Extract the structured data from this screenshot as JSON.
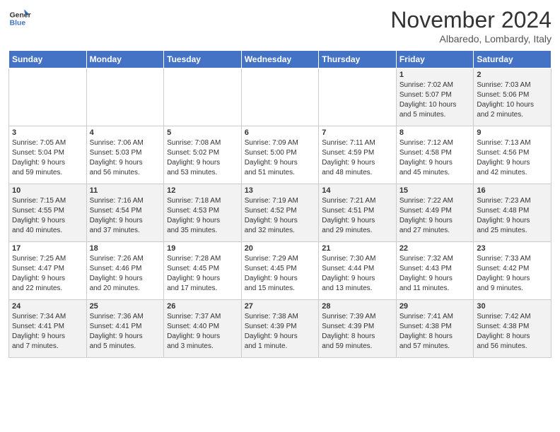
{
  "header": {
    "logo_general": "General",
    "logo_blue": "Blue",
    "month_title": "November 2024",
    "location": "Albaredo, Lombardy, Italy"
  },
  "days_of_week": [
    "Sunday",
    "Monday",
    "Tuesday",
    "Wednesday",
    "Thursday",
    "Friday",
    "Saturday"
  ],
  "weeks": [
    [
      {
        "day": "",
        "info": ""
      },
      {
        "day": "",
        "info": ""
      },
      {
        "day": "",
        "info": ""
      },
      {
        "day": "",
        "info": ""
      },
      {
        "day": "",
        "info": ""
      },
      {
        "day": "1",
        "info": "Sunrise: 7:02 AM\nSunset: 5:07 PM\nDaylight: 10 hours\nand 5 minutes."
      },
      {
        "day": "2",
        "info": "Sunrise: 7:03 AM\nSunset: 5:06 PM\nDaylight: 10 hours\nand 2 minutes."
      }
    ],
    [
      {
        "day": "3",
        "info": "Sunrise: 7:05 AM\nSunset: 5:04 PM\nDaylight: 9 hours\nand 59 minutes."
      },
      {
        "day": "4",
        "info": "Sunrise: 7:06 AM\nSunset: 5:03 PM\nDaylight: 9 hours\nand 56 minutes."
      },
      {
        "day": "5",
        "info": "Sunrise: 7:08 AM\nSunset: 5:02 PM\nDaylight: 9 hours\nand 53 minutes."
      },
      {
        "day": "6",
        "info": "Sunrise: 7:09 AM\nSunset: 5:00 PM\nDaylight: 9 hours\nand 51 minutes."
      },
      {
        "day": "7",
        "info": "Sunrise: 7:11 AM\nSunset: 4:59 PM\nDaylight: 9 hours\nand 48 minutes."
      },
      {
        "day": "8",
        "info": "Sunrise: 7:12 AM\nSunset: 4:58 PM\nDaylight: 9 hours\nand 45 minutes."
      },
      {
        "day": "9",
        "info": "Sunrise: 7:13 AM\nSunset: 4:56 PM\nDaylight: 9 hours\nand 42 minutes."
      }
    ],
    [
      {
        "day": "10",
        "info": "Sunrise: 7:15 AM\nSunset: 4:55 PM\nDaylight: 9 hours\nand 40 minutes."
      },
      {
        "day": "11",
        "info": "Sunrise: 7:16 AM\nSunset: 4:54 PM\nDaylight: 9 hours\nand 37 minutes."
      },
      {
        "day": "12",
        "info": "Sunrise: 7:18 AM\nSunset: 4:53 PM\nDaylight: 9 hours\nand 35 minutes."
      },
      {
        "day": "13",
        "info": "Sunrise: 7:19 AM\nSunset: 4:52 PM\nDaylight: 9 hours\nand 32 minutes."
      },
      {
        "day": "14",
        "info": "Sunrise: 7:21 AM\nSunset: 4:51 PM\nDaylight: 9 hours\nand 29 minutes."
      },
      {
        "day": "15",
        "info": "Sunrise: 7:22 AM\nSunset: 4:49 PM\nDaylight: 9 hours\nand 27 minutes."
      },
      {
        "day": "16",
        "info": "Sunrise: 7:23 AM\nSunset: 4:48 PM\nDaylight: 9 hours\nand 25 minutes."
      }
    ],
    [
      {
        "day": "17",
        "info": "Sunrise: 7:25 AM\nSunset: 4:47 PM\nDaylight: 9 hours\nand 22 minutes."
      },
      {
        "day": "18",
        "info": "Sunrise: 7:26 AM\nSunset: 4:46 PM\nDaylight: 9 hours\nand 20 minutes."
      },
      {
        "day": "19",
        "info": "Sunrise: 7:28 AM\nSunset: 4:45 PM\nDaylight: 9 hours\nand 17 minutes."
      },
      {
        "day": "20",
        "info": "Sunrise: 7:29 AM\nSunset: 4:45 PM\nDaylight: 9 hours\nand 15 minutes."
      },
      {
        "day": "21",
        "info": "Sunrise: 7:30 AM\nSunset: 4:44 PM\nDaylight: 9 hours\nand 13 minutes."
      },
      {
        "day": "22",
        "info": "Sunrise: 7:32 AM\nSunset: 4:43 PM\nDaylight: 9 hours\nand 11 minutes."
      },
      {
        "day": "23",
        "info": "Sunrise: 7:33 AM\nSunset: 4:42 PM\nDaylight: 9 hours\nand 9 minutes."
      }
    ],
    [
      {
        "day": "24",
        "info": "Sunrise: 7:34 AM\nSunset: 4:41 PM\nDaylight: 9 hours\nand 7 minutes."
      },
      {
        "day": "25",
        "info": "Sunrise: 7:36 AM\nSunset: 4:41 PM\nDaylight: 9 hours\nand 5 minutes."
      },
      {
        "day": "26",
        "info": "Sunrise: 7:37 AM\nSunset: 4:40 PM\nDaylight: 9 hours\nand 3 minutes."
      },
      {
        "day": "27",
        "info": "Sunrise: 7:38 AM\nSunset: 4:39 PM\nDaylight: 9 hours\nand 1 minute."
      },
      {
        "day": "28",
        "info": "Sunrise: 7:39 AM\nSunset: 4:39 PM\nDaylight: 8 hours\nand 59 minutes."
      },
      {
        "day": "29",
        "info": "Sunrise: 7:41 AM\nSunset: 4:38 PM\nDaylight: 8 hours\nand 57 minutes."
      },
      {
        "day": "30",
        "info": "Sunrise: 7:42 AM\nSunset: 4:38 PM\nDaylight: 8 hours\nand 56 minutes."
      }
    ]
  ]
}
